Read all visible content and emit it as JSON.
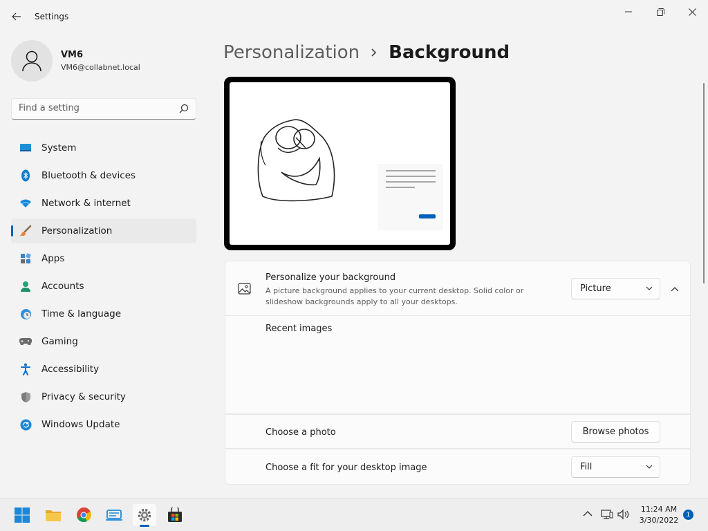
{
  "window": {
    "title": "Settings"
  },
  "user": {
    "name": "VM6",
    "email": "VM6@collabnet.local"
  },
  "search": {
    "placeholder": "Find a setting"
  },
  "sidebar": {
    "items": [
      {
        "label": "System",
        "icon": "monitor-icon"
      },
      {
        "label": "Bluetooth & devices",
        "icon": "bluetooth-icon"
      },
      {
        "label": "Network & internet",
        "icon": "wifi-icon"
      },
      {
        "label": "Personalization",
        "icon": "brush-icon",
        "active": true
      },
      {
        "label": "Apps",
        "icon": "apps-icon"
      },
      {
        "label": "Accounts",
        "icon": "person-icon"
      },
      {
        "label": "Time & language",
        "icon": "clock-globe-icon"
      },
      {
        "label": "Gaming",
        "icon": "gamepad-icon"
      },
      {
        "label": "Accessibility",
        "icon": "accessibility-icon"
      },
      {
        "label": "Privacy & security",
        "icon": "shield-icon"
      },
      {
        "label": "Windows Update",
        "icon": "update-icon"
      }
    ]
  },
  "header": {
    "parent": "Personalization",
    "current": "Background"
  },
  "background": {
    "title": "Personalize your background",
    "description": "A picture background applies to your current desktop. Solid color or slideshow backgrounds apply to all your desktops.",
    "type_value": "Picture",
    "recent_label": "Recent images",
    "choose_photo_label": "Choose a photo",
    "browse_button": "Browse photos",
    "fit_label": "Choose a fit for your desktop image",
    "fit_value": "Fill"
  },
  "taskbar": {
    "apps": [
      "start-icon",
      "file-explorer-icon",
      "chrome-icon",
      "remote-desktop-icon",
      "settings-icon",
      "store-icon"
    ],
    "time": "11:24 AM",
    "date": "3/30/2022",
    "notification_count": "1"
  },
  "colors": {
    "accent": "#005fb8",
    "background": "#f3f3f3",
    "card": "#fbfbfb"
  }
}
